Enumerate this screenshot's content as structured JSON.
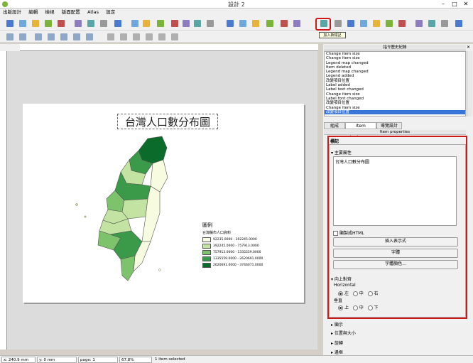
{
  "window": {
    "title": "設計 2"
  },
  "menu": [
    "出版設計",
    "編輯",
    "檢視",
    "版面配置",
    "Atlas",
    "設定"
  ],
  "tooltip": "加入新標記",
  "map": {
    "title": "台灣人口數分布圖",
    "legend": {
      "title": "圖例",
      "subtitle": "台灣縣市人口資料",
      "items": [
        {
          "label": "92235.0000 - 392245.0000",
          "color": "#f7fbe0"
        },
        {
          "label": "392245.0000 - 757913.0000",
          "color": "#c2e3a2"
        },
        {
          "label": "757913.0000 - 1335559.0000",
          "color": "#7cc36c"
        },
        {
          "label": "1335559.0000 - 2620691.0000",
          "color": "#3a9a4a"
        },
        {
          "label": "2620691.0000 - 3746071.0000",
          "color": "#0b6b2b"
        }
      ]
    }
  },
  "history": {
    "header": "指令歷史紀錄",
    "entries": [
      "Change item size",
      "Change item size",
      "Legend map changed",
      "Item deleted",
      "Legend map changed",
      "Legend added",
      "改變項目位置",
      "Label added",
      "Label text changed",
      "Change item size",
      "Label font changed",
      "改變項目位置",
      "Change item size",
      "改變項目位置"
    ]
  },
  "tabs": [
    "組成",
    "Item properties",
    "導覽設計"
  ],
  "item_properties": {
    "header": "Item properties",
    "section_title": "標記",
    "main_props": "主要屬性",
    "text_value": "台灣人口數分布圖",
    "render_html": "顯製成HTML",
    "insert_expr": "插入表示式",
    "font": "字體",
    "font_color": "字體顏色...",
    "alignment": "向上對齊",
    "horizontal": "Horizontal",
    "h_options": [
      "左",
      "中",
      "右"
    ],
    "vertical": "垂直",
    "v_options": [
      "上",
      "中",
      "下"
    ],
    "collapsed": [
      "顯示",
      "位置與大小",
      "旋轉",
      "邊框"
    ]
  },
  "status": {
    "x": "x: 240.9 mm",
    "y": "y: 0 mm",
    "page": "page: 1",
    "zoom": "67.8%",
    "selected": "1 item selected"
  }
}
